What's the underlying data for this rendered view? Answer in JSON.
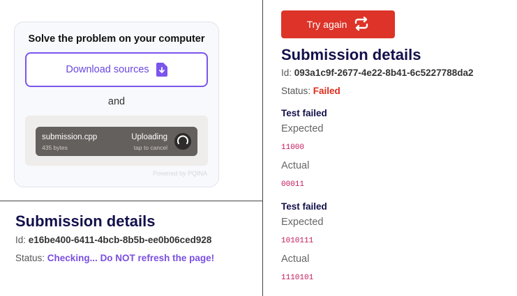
{
  "upload_card": {
    "title": "Solve the problem on your computer",
    "download_label": "Download sources",
    "and_text": "and",
    "file": {
      "name": "submission.cpp",
      "size": "435 bytes",
      "status": "Uploading",
      "sub_status": "tap to cancel"
    },
    "powered_by": "Powered by PQINA"
  },
  "left_submission": {
    "title": "Submission details",
    "id_label": "Id:",
    "id_value": "e16be400-6411-4bcb-8b5b-ee0b06ced928",
    "status_label": "Status:",
    "status_value": "Checking... Do NOT refresh the page!"
  },
  "right_submission": {
    "try_again_label": "Try again",
    "title": "Submission details",
    "id_label": "Id:",
    "id_value": "093a1c9f-2677-4e22-8b41-6c5227788da2",
    "status_label": "Status:",
    "status_value": "Failed",
    "tests": [
      {
        "heading": "Test failed",
        "expected_label": "Expected",
        "expected": "11000",
        "actual_label": "Actual",
        "actual": "00011"
      },
      {
        "heading": "Test failed",
        "expected_label": "Expected",
        "expected": "1010111",
        "actual_label": "Actual",
        "actual": "1110101"
      }
    ]
  },
  "colors": {
    "accent_purple": "#7b55ec",
    "failed_red": "#dd2b1c",
    "try_again_bg": "#dd3328",
    "code_pink": "#c2185b"
  },
  "icons": {
    "download": "file-download-icon",
    "retry": "retry-arrows-icon",
    "spinner": "spinner-icon"
  }
}
